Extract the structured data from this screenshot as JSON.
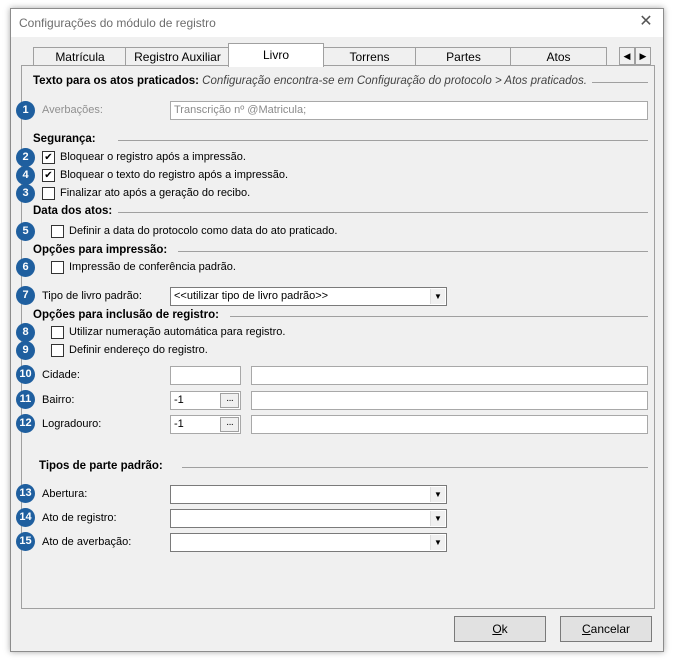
{
  "window": {
    "title": "Configurações do módulo de registro",
    "close": "✕"
  },
  "tabs": [
    "Matrícula",
    "Registro Auxiliar",
    "Livro",
    "Torrens",
    "Partes",
    "Atos"
  ],
  "active_tab": "Livro",
  "tab_scroll": {
    "left": "◀",
    "right": "▶"
  },
  "section_texto": {
    "title": "Texto para os atos praticados:",
    "note": "Configuração encontra-se em Configuração do protocolo > Atos praticados."
  },
  "averbacoes": {
    "badge": "1",
    "label": "Averbações:",
    "value": "Transcrição nº @Matricula;"
  },
  "section_seguranca": {
    "title": "Segurança:"
  },
  "seg_items": [
    {
      "badge": "2",
      "label": "Bloquear o registro após a impressão.",
      "mark": "✔"
    },
    {
      "badge": "4",
      "label": "Bloquear o texto do registro após a impressão.",
      "mark": "✔"
    },
    {
      "badge": "3",
      "label": "Finalizar ato após a geração do recibo.",
      "mark": ""
    }
  ],
  "section_data": {
    "title": "Data dos atos:"
  },
  "data_item": {
    "badge": "5",
    "label": "Definir a data do protocolo como data do ato praticado.",
    "mark": ""
  },
  "section_impressao": {
    "title": "Opções para impressão:"
  },
  "imp_item": {
    "badge": "6",
    "label": "Impressão de conferência padrão.",
    "mark": ""
  },
  "tipo_livro": {
    "badge": "7",
    "label": "Tipo de livro padrão:",
    "value": "<<utilizar tipo de livro padrão>>"
  },
  "section_inclusao": {
    "title": "Opções para inclusão de registro:"
  },
  "inc_items": [
    {
      "badge": "8",
      "label": "Utilizar numeração automática para registro.",
      "mark": ""
    },
    {
      "badge": "9",
      "label": "Definir endereço do registro.",
      "mark": ""
    }
  ],
  "cidade": {
    "badge": "10",
    "label": "Cidade:",
    "code": "",
    "name": ""
  },
  "bairro": {
    "badge": "11",
    "label": "Bairro:",
    "code": "-1",
    "name": ""
  },
  "logradouro": {
    "badge": "12",
    "label": "Logradouro:",
    "code": "-1",
    "name": ""
  },
  "ellipsis": "···",
  "section_partes": {
    "title": "Tipos de parte padrão:"
  },
  "abertura": {
    "badge": "13",
    "label": "Abertura:",
    "value": ""
  },
  "ato_registro": {
    "badge": "14",
    "label": "Ato de registro:",
    "value": ""
  },
  "ato_averbacao": {
    "badge": "15",
    "label": "Ato de averbação:",
    "value": ""
  },
  "combo_arrow": "▼",
  "buttons": {
    "ok_accel": "O",
    "ok_rest": "k",
    "cancel_accel": "C",
    "cancel_rest": "ancelar"
  }
}
